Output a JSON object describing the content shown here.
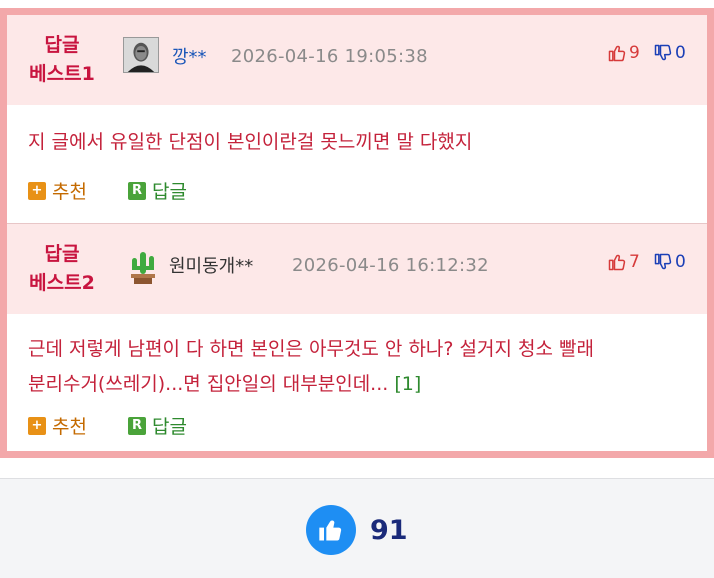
{
  "best_comments": [
    {
      "badge_line1": "답글",
      "badge_line2": "베스트1",
      "avatar_icon": "portrait-avatar-icon",
      "nickname": "깡**",
      "date": "2026-04-16 19:05:38",
      "up_count": "9",
      "down_count": "0",
      "body_text": "지 글에서 유일한 단점이 본인이란걸 못느끼면 말 다했지",
      "body_line2": "",
      "reply_ref": "",
      "recommend_label": "추천",
      "reply_label": "답글"
    },
    {
      "badge_line1": "답글",
      "badge_line2": "베스트2",
      "avatar_icon": "cactus-avatar-icon",
      "nickname": "원미동개**",
      "date": "2026-04-16 16:12:32",
      "up_count": "7",
      "down_count": "0",
      "body_text": "근데 저렇게 남편이 다 하면 본인은 아무것도 안 하나? 설거지 청소 빨래",
      "body_line2": "분리수거(쓰레기)...면 집안일의 대부분인데...",
      "reply_ref": "[1]",
      "recommend_label": "추천",
      "reply_label": "답글"
    }
  ],
  "footer": {
    "like_count": "91",
    "like_icon": "thumbs-up-icon"
  },
  "colors": {
    "badge_red": "#c8143f",
    "border_pink": "#f3a8aa",
    "header_bg": "#fde8e8",
    "like_blue": "#1e8ef3"
  }
}
